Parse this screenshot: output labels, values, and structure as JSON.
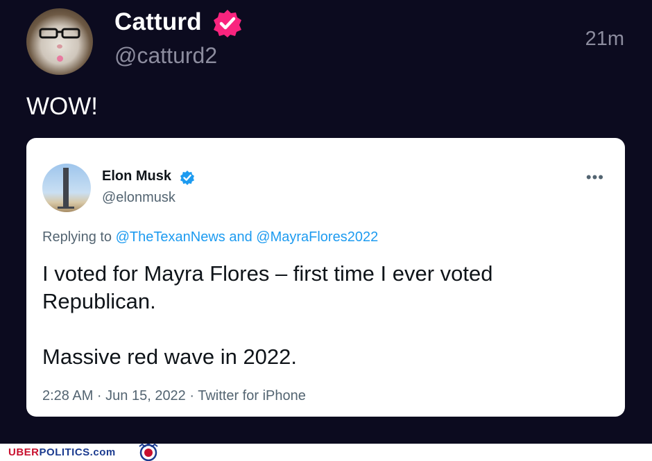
{
  "post": {
    "author_name": "Catturd",
    "handle": "@catturd2",
    "time": "21m",
    "text": "WOW!",
    "verified_color": "#f9247e"
  },
  "quoted_tweet": {
    "author_name": "Elon Musk",
    "handle": "@elonmusk",
    "reply_prefix": "Replying to",
    "mention_1": "@TheTexanNews",
    "reply_and": "and",
    "mention_2": "@MayraFlores2022",
    "body_line_1": "I voted for Mayra Flores – first time I ever voted Republican.",
    "body_line_2": "Massive red wave in 2022.",
    "meta": "2:28 AM · Jun 15, 2022 · Twitter for iPhone",
    "more_label": "•••",
    "verified_color": "#1d9bf0"
  },
  "footer": {
    "brand_part_1": "UBER",
    "brand_part_2": "POLITICS.com"
  }
}
